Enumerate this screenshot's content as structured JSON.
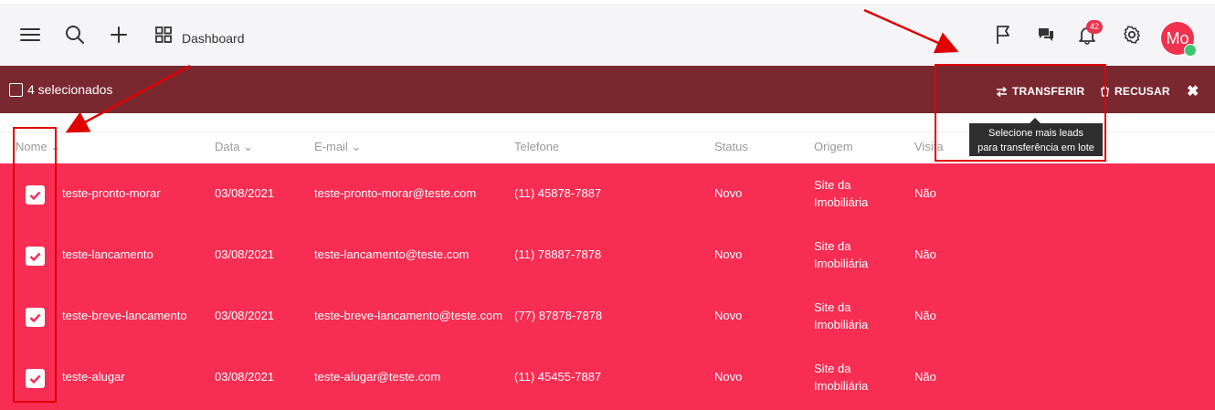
{
  "header": {
    "dashboard_label": "Dashboard",
    "notification_count": "42",
    "avatar_initials": "Mo",
    "icons": [
      "menu-icon",
      "search-icon",
      "plus-icon",
      "grid-icon",
      "flag-icon",
      "chat-icon",
      "bell-icon",
      "gear-icon"
    ]
  },
  "selection": {
    "label": "4 selecionados",
    "transfer_label": "TRANSFERIR",
    "refuse_label": "RECUSAR",
    "close_icon": "close-icon"
  },
  "tooltip": {
    "line1": "Selecione mais leads",
    "line2": "para transferência em lote"
  },
  "table": {
    "columns": {
      "nome": "Nome",
      "data": "Data",
      "email": "E-mail",
      "telefone": "Telefone",
      "status": "Status",
      "origem": "Origem",
      "visita": "Visita"
    },
    "rows": [
      {
        "nome": "teste-pronto-morar",
        "data": "03/08/2021",
        "email": "teste-pronto-morar@teste.com",
        "telefone": "(11) 45878-7887",
        "status": "Novo",
        "origem_1": "Site da",
        "origem_2": "Imobiliária",
        "visita": "Não",
        "checked": true
      },
      {
        "nome": "teste-lancamento",
        "data": "03/08/2021",
        "email": "teste-lancamento@teste.com",
        "telefone": "(11) 78887-7878",
        "status": "Novo",
        "origem_1": "Site da",
        "origem_2": "Imobiliária",
        "visita": "Não",
        "checked": true
      },
      {
        "nome": "teste-breve-lancamento",
        "data": "03/08/2021",
        "email": "teste-breve-lancamento@teste.com",
        "telefone": "(77) 87878-7878",
        "status": "Novo",
        "origem_1": "Site da",
        "origem_2": "Imobiliária",
        "visita": "Não",
        "checked": true
      },
      {
        "nome": "teste-alugar",
        "data": "03/08/2021",
        "email": "teste-alugar@teste.com",
        "telefone": "(11) 45455-7887",
        "status": "Novo",
        "origem_1": "Site da",
        "origem_2": "Imobiliária",
        "visita": "Não",
        "checked": true
      }
    ]
  },
  "colors": {
    "selection_bar": "#7a2830",
    "row_highlight": "#f72d53",
    "annotation": "#e00000"
  }
}
